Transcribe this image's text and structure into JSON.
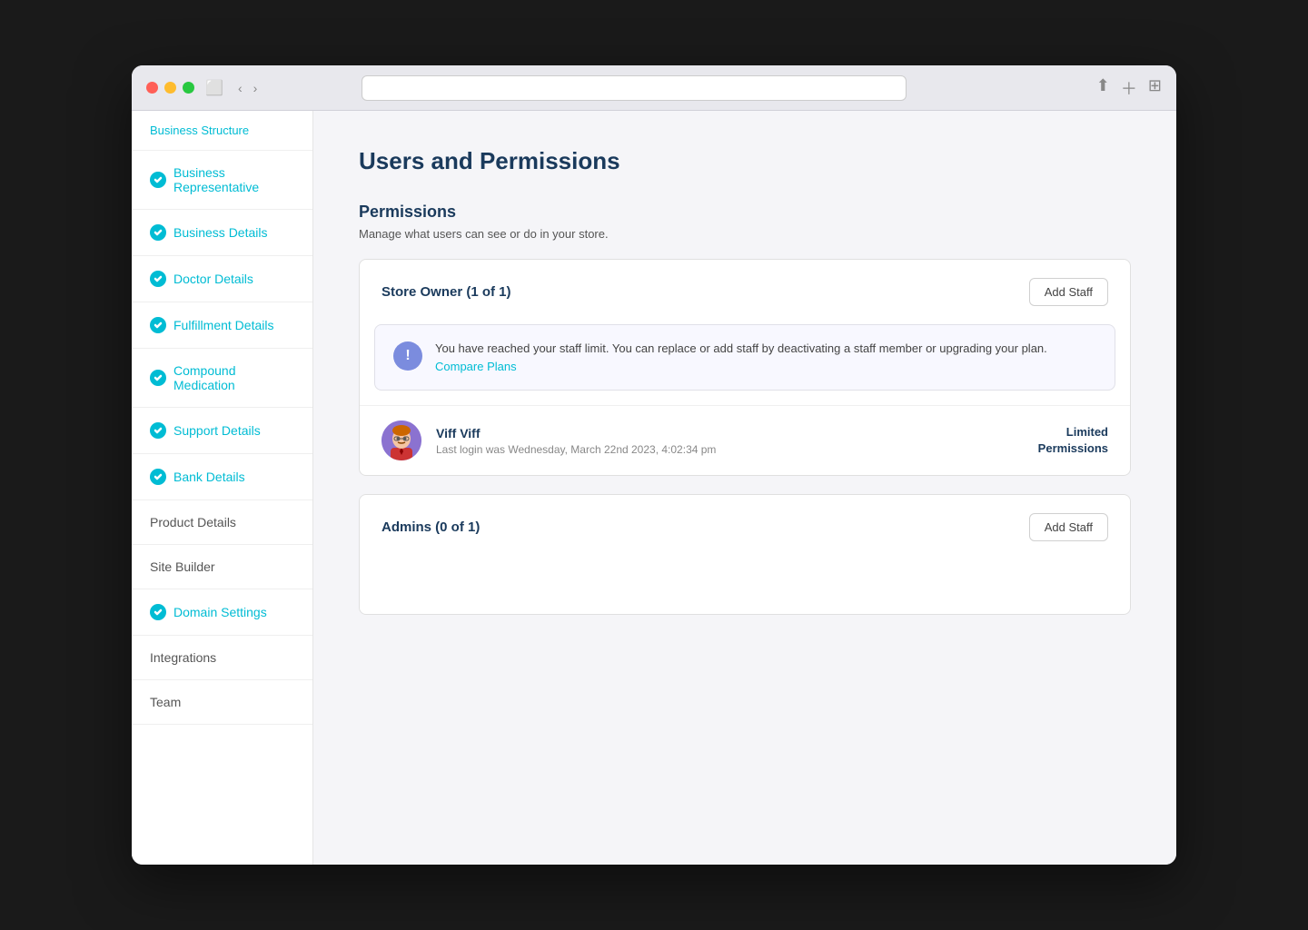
{
  "browser": {
    "traffic_lights": [
      "red",
      "yellow",
      "green"
    ]
  },
  "sidebar": {
    "top_item": "Business Structure",
    "items": [
      {
        "id": "business-representative",
        "label": "Business Representative",
        "completed": true
      },
      {
        "id": "business-details",
        "label": "Business Details",
        "completed": true
      },
      {
        "id": "doctor-details",
        "label": "Doctor Details",
        "completed": true
      },
      {
        "id": "fulfillment-details",
        "label": "Fulfillment Details",
        "completed": true
      },
      {
        "id": "compound-medication",
        "label": "Compound Medication",
        "completed": true
      },
      {
        "id": "support-details",
        "label": "Support Details",
        "completed": true
      },
      {
        "id": "bank-details",
        "label": "Bank Details",
        "completed": true
      },
      {
        "id": "product-details",
        "label": "Product Details",
        "completed": false
      },
      {
        "id": "site-builder",
        "label": "Site Builder",
        "completed": false
      },
      {
        "id": "domain-settings",
        "label": "Domain Settings",
        "completed": true
      },
      {
        "id": "integrations",
        "label": "Integrations",
        "completed": false
      },
      {
        "id": "team",
        "label": "Team",
        "completed": false
      }
    ]
  },
  "main": {
    "page_title": "Users and Permissions",
    "section_title": "Permissions",
    "section_subtitle": "Manage what users can see or do in your store.",
    "store_owner_card": {
      "title": "Store Owner (1 of 1)",
      "add_staff_label": "Add Staff",
      "alert": {
        "text": "You have reached your staff limit. You can replace or add staff by deactivating a staff member or upgrading your plan.",
        "link_text": "Compare Plans",
        "link_href": "#"
      },
      "staff": [
        {
          "name": "Viff Viff",
          "last_login": "Last login was Wednesday, March 22nd 2023, 4:02:34 pm",
          "permissions": "Limited\nPermissions"
        }
      ]
    },
    "admins_card": {
      "title": "Admins (0 of 1)",
      "add_staff_label": "Add Staff"
    }
  }
}
